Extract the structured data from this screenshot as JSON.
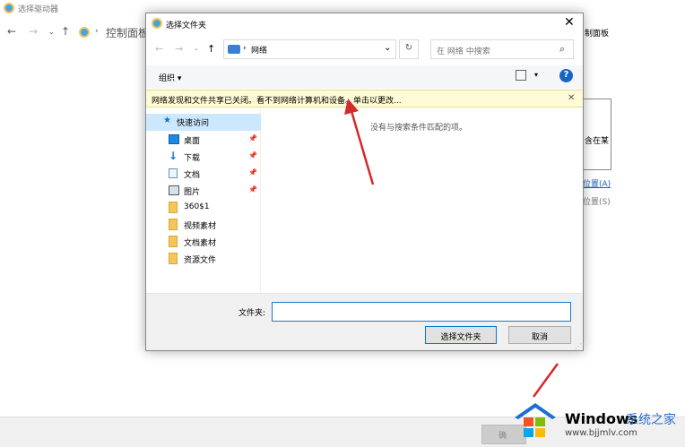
{
  "background": {
    "window_title": "选择驱动器",
    "address": "控制面板",
    "right_fragments": [
      "制面板",
      "含在某",
      "位置(A)",
      "位置(S)"
    ],
    "ok_button_partial": "确"
  },
  "dialog": {
    "title": "选择文件夹",
    "address_path": "网络",
    "search_placeholder": "在 网络 中搜索",
    "organize_label": "组织 ▾",
    "info_bar": "网络发现和文件共享已关闭。看不到网络计算机和设备。单击以更改...",
    "empty_message": "没有与搜索条件匹配的项。",
    "folder_field_label": "文件夹:",
    "folder_field_value": "",
    "select_button": "选择文件夹",
    "cancel_button": "取消",
    "sidebar": {
      "quick_access": "快速访问",
      "items": [
        {
          "label": "桌面",
          "icon": "desktop-icon",
          "pinned": true
        },
        {
          "label": "下载",
          "icon": "download-icon",
          "pinned": true
        },
        {
          "label": "文档",
          "icon": "document-icon",
          "pinned": true
        },
        {
          "label": "图片",
          "icon": "picture-icon",
          "pinned": true
        },
        {
          "label": "360$1",
          "icon": "folder-icon",
          "pinned": false
        },
        {
          "label": "视频素材",
          "icon": "folder-icon",
          "pinned": false
        },
        {
          "label": "文档素材",
          "icon": "folder-icon",
          "pinned": false
        },
        {
          "label": "资源文件",
          "icon": "folder-icon",
          "pinned": false
        }
      ]
    }
  },
  "watermark": {
    "brand": "Windows",
    "brand_cn": "系统之家",
    "url": "www.bjjmlv.com"
  },
  "colors": {
    "accent": "#0078d7",
    "arrow": "#d42a2a",
    "info_bar": "#fffbd6"
  }
}
